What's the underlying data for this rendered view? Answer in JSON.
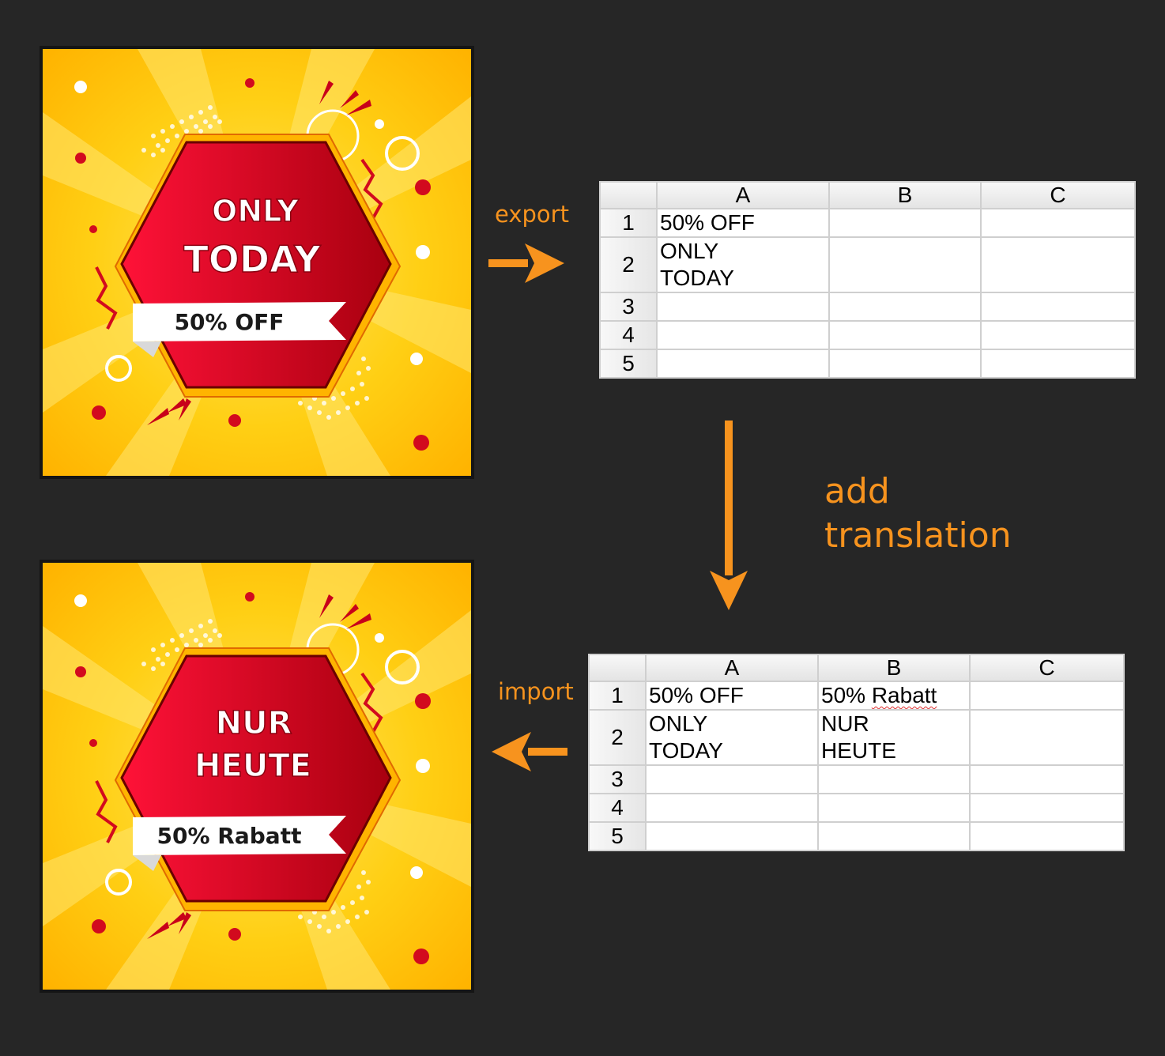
{
  "flow": {
    "export_label": "export",
    "translate_label_line1": "add",
    "translate_label_line2": "translation",
    "import_label": "import"
  },
  "banner_original": {
    "headline_line1": "ONLY",
    "headline_line2": "TODAY",
    "ribbon": "50% OFF"
  },
  "banner_translated": {
    "headline_line1": "NUR",
    "headline_line2": "HEUTE",
    "ribbon": "50% Rabatt"
  },
  "sheet_export": {
    "columns": [
      "A",
      "B",
      "C"
    ],
    "rows": [
      "1",
      "2",
      "3",
      "4",
      "5"
    ],
    "a1": "50% OFF",
    "a2_line1": "ONLY",
    "a2_line2": "TODAY",
    "b1": "",
    "b2_line1": "",
    "b2_line2": ""
  },
  "sheet_import": {
    "columns": [
      "A",
      "B",
      "C"
    ],
    "rows": [
      "1",
      "2",
      "3",
      "4",
      "5"
    ],
    "a1": "50% OFF",
    "a2_line1": "ONLY",
    "a2_line2": "TODAY",
    "b1": "50% ",
    "b1_flagged": "Rabatt",
    "b2_line1": "NUR",
    "b2_line2": "HEUTE"
  },
  "colors": {
    "background": "#262626",
    "accent_orange": "#f7931e",
    "banner_yellow": "#ffc800",
    "badge_red": "#d4001c",
    "ribbon_white": "#ffffff"
  }
}
